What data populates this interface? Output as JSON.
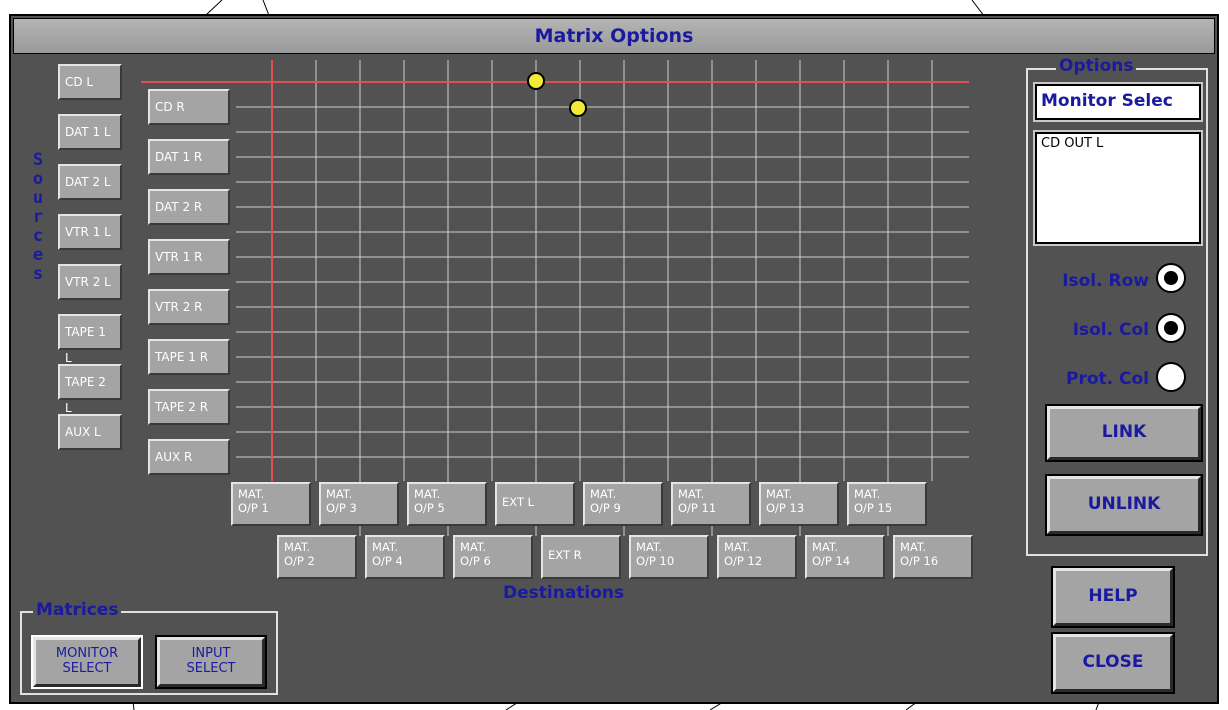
{
  "window": {
    "title": "Matrix Options"
  },
  "labels": {
    "sources": "Sources",
    "destinations": "Destinations"
  },
  "sources": {
    "left": [
      "CD L",
      "DAT 1 L",
      "DAT 2 L",
      "VTR 1 L",
      "VTR 2 L",
      "TAPE 1 L",
      "TAPE 2 L",
      "AUX L"
    ],
    "right": [
      "CD R",
      "DAT 1 R",
      "DAT 2 R",
      "VTR 1 R",
      "VTR 2 R",
      "TAPE 1 R",
      "TAPE 2 R",
      "AUX R"
    ]
  },
  "destinations": {
    "row1": [
      "MAT.\nO/P 1",
      "MAT.\nO/P 3",
      "MAT.\nO/P 5",
      "EXT L",
      "MAT.\nO/P 9",
      "MAT.\nO/P 11",
      "MAT.\nO/P 13",
      "MAT.\nO/P 15"
    ],
    "row2": [
      "MAT.\nO/P 2",
      "MAT.\nO/P 4",
      "MAT.\nO/P 6",
      "EXT R",
      "MAT.\nO/P 10",
      "MAT.\nO/P 12",
      "MAT.\nO/P 14",
      "MAT.\nO/P 16"
    ]
  },
  "options": {
    "title": "Options",
    "selected_matrix": "Monitor Selec",
    "selected_output": "CD OUT L",
    "isol_row": "Isol. Row",
    "isol_col": "Isol. Col",
    "prot_col": "Prot. Col",
    "isol_row_checked": true,
    "isol_col_checked": true,
    "prot_col_checked": false,
    "link": "LINK",
    "unlink": "UNLINK"
  },
  "buttons": {
    "help": "HELP",
    "close": "CLOSE"
  },
  "matrices": {
    "title": "Matrices",
    "monitor_select": "MONITOR\nSELECT",
    "input_select": "INPUT\nSELECT"
  },
  "colors": {
    "panel": "#525252",
    "label_blue": "#1a1aa0",
    "grid": "#cfcfcf",
    "highlight": "#e05050",
    "knob": "#f2ea37"
  }
}
